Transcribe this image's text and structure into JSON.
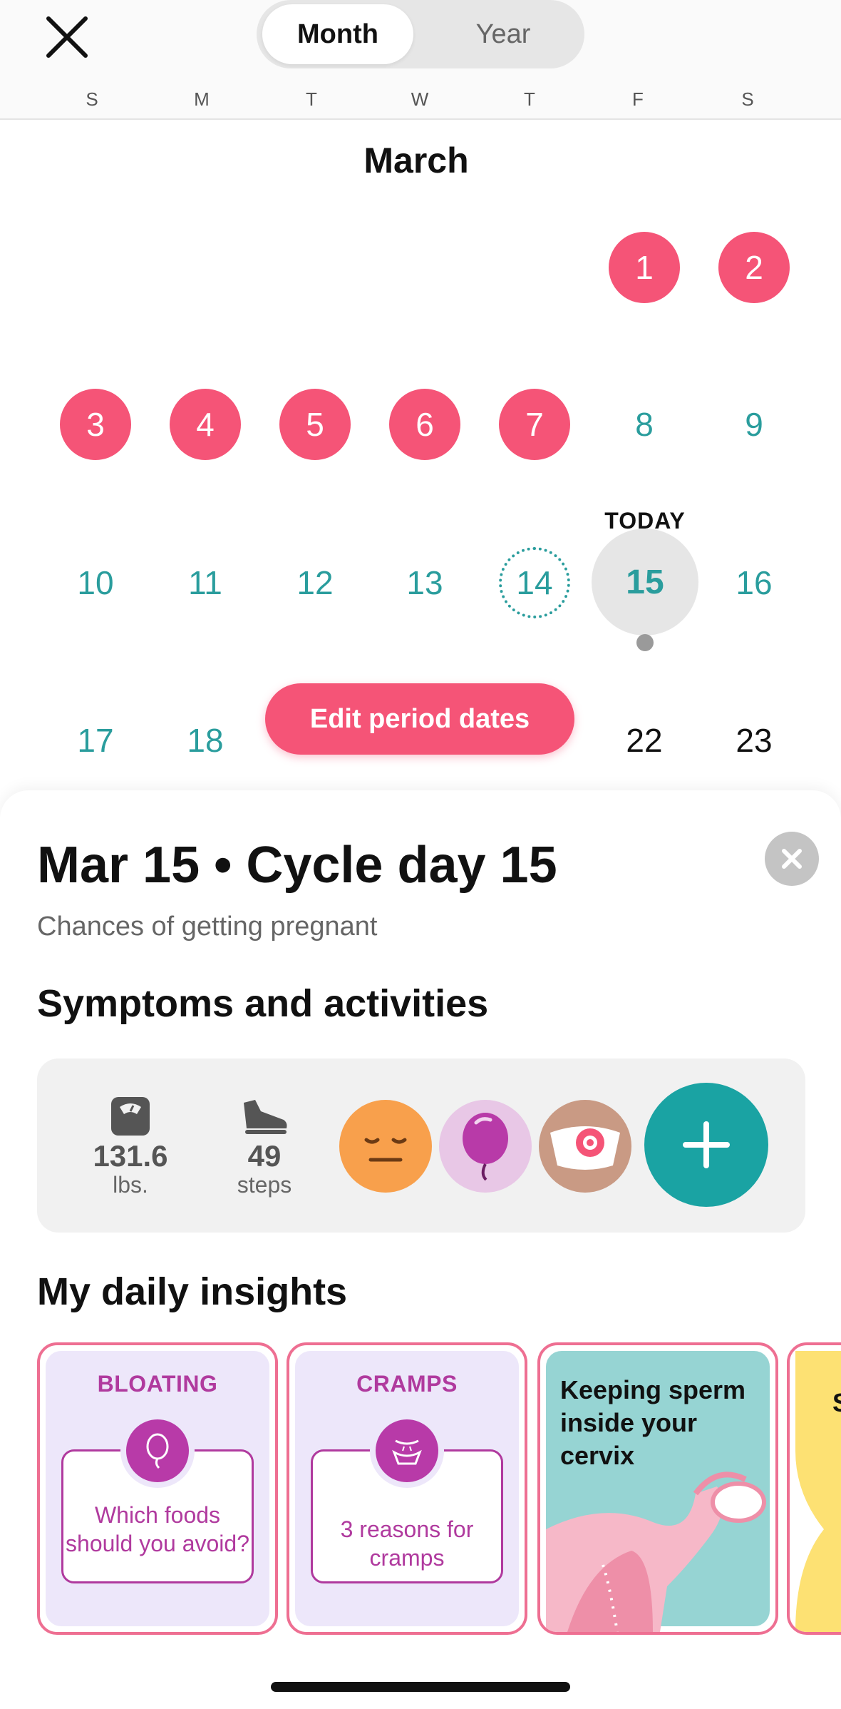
{
  "header": {
    "segments": {
      "month": "Month",
      "year": "Year"
    },
    "weekdays": [
      "S",
      "M",
      "T",
      "W",
      "T",
      "F",
      "S"
    ]
  },
  "calendar": {
    "month": "March",
    "days": {
      "d1": "1",
      "d2": "2",
      "d3": "3",
      "d4": "4",
      "d5": "5",
      "d6": "6",
      "d7": "7",
      "d8": "8",
      "d9": "9",
      "d10": "10",
      "d11": "11",
      "d12": "12",
      "d13": "13",
      "d14": "14",
      "d15": "15",
      "d16": "16",
      "d17": "17",
      "d18": "18",
      "d22": "22",
      "d23": "23"
    },
    "today_label": "TODAY",
    "edit_button": "Edit period dates"
  },
  "sheet": {
    "title": "Mar 15 • Cycle day 15",
    "subtitle": "Chances of getting pregnant",
    "symptoms_heading": "Symptoms and activities",
    "weight_value": "131.6",
    "weight_unit": "lbs.",
    "steps_value": "49",
    "steps_unit": "steps",
    "insights_heading": "My daily insights"
  },
  "insights": [
    {
      "category": "BLOATING",
      "text": "Which foods should you avoid?"
    },
    {
      "category": "CRAMPS",
      "text": "3 reasons for cramps"
    },
    {
      "title": "Keeping sperm inside your cervix"
    },
    {
      "partial": "S"
    }
  ],
  "colors": {
    "period": "#f55477",
    "teal": "#2a9d9d",
    "accent_purple": "#b03a9e"
  }
}
